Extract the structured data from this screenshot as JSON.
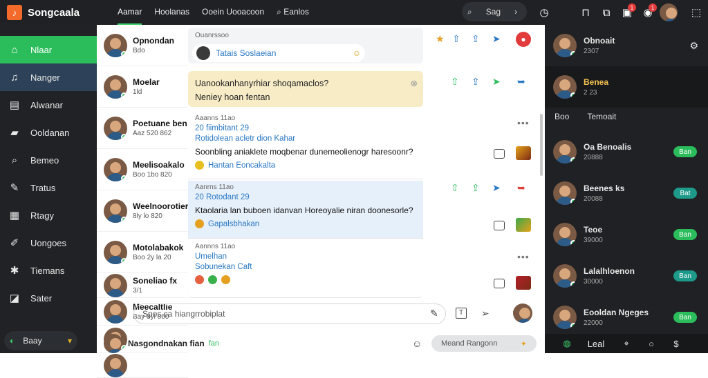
{
  "app": {
    "name": "Songcaala"
  },
  "topnav": {
    "tabs": [
      "Aamar",
      "Hoolanas",
      "Ooein Uooacoon",
      "Eanlos"
    ],
    "search_label": "Sag"
  },
  "sidebar": {
    "items": [
      {
        "label": "Nlaar",
        "icon": "home-icon"
      },
      {
        "label": "Nanger",
        "icon": "music-icon"
      },
      {
        "label": "Alwanar",
        "icon": "library-icon"
      },
      {
        "label": "Ooldanan",
        "icon": "folder-icon"
      },
      {
        "label": "Bemeo",
        "icon": "search-icon"
      },
      {
        "label": "Tratus",
        "icon": "tools-icon"
      },
      {
        "label": "Rtagy",
        "icon": "store-icon"
      },
      {
        "label": "Uongoes",
        "icon": "microphone-icon"
      },
      {
        "label": "Tiemans",
        "icon": "settings-icon"
      },
      {
        "label": "Sater",
        "icon": "bookmark-icon"
      }
    ],
    "toggle_label": "Baay"
  },
  "chats": [
    {
      "name": "Opnondan",
      "sub": "Bdo"
    },
    {
      "name": "Moelar",
      "sub": "1ld"
    },
    {
      "name": "Poetuane ben",
      "sub": "Aaz 520 862"
    },
    {
      "name": "Meelisoakalo",
      "sub": "Boo 1bo 820"
    },
    {
      "name": "Weelnoorotier",
      "sub": "8ly lo 820"
    },
    {
      "name": "Motolabakok",
      "sub": "Boo 2y la 20"
    },
    {
      "name": "Soneliao fx",
      "sub": "3/1"
    },
    {
      "name": "Meecaltlie",
      "sub": "Bay 8yl 860"
    },
    {
      "name": "",
      "sub": ""
    },
    {
      "name": "Nasgondnakan fian",
      "sub": "",
      "tag": "fan"
    }
  ],
  "thread": {
    "sticky_label": "Ouanrssoo",
    "sticky_pill": "Tatais Soslaeian",
    "question": "Uanookanhanyrhiar shoqamaclos?",
    "question_sub": "Neniey hoan fentan",
    "cards": [
      {
        "meta": "Aaanns 11ao",
        "line": "20 fiimbitant   29",
        "body_top": "Rotidolean acletr dion Kahar",
        "body": "Soonbling aniaklete moqbenar dunemeolienogr haresoonr?",
        "foot": "Hantan   Eoncakalta"
      },
      {
        "meta": "Aanrns 11ao",
        "line": "20 Rotodant   29",
        "body": "Ktaolaria lan buboen idanvan Horeoyalie niran doonesorle?",
        "foot": "Gapalsbhakan"
      },
      {
        "meta": "Aannns 11ao",
        "line": "Umelhan",
        "body": "Sobunekan Caft",
        "foot": ""
      }
    ]
  },
  "composer": {
    "placeholder": "Spos ca hiangrrobiplat"
  },
  "bottom": {
    "name": "Nasgondnakan fian",
    "tag": "fan",
    "pill": "Meand Rangonn"
  },
  "right": {
    "profile": {
      "name": "Obnoait",
      "sub": "2307"
    },
    "featured": {
      "name": "Benea",
      "sub": "2 23"
    },
    "tabs": [
      "Boo",
      "Temoait"
    ],
    "contacts": [
      {
        "name": "Oa Benoalis",
        "sub": "20888",
        "btn": "Ban",
        "color": "#2bbd5b"
      },
      {
        "name": "Beenes ks",
        "sub": "20088",
        "btn": "Bat",
        "color": "#1e9a8a"
      },
      {
        "name": "Teoe",
        "sub": "39000",
        "btn": "Ban",
        "color": "#2bbd5b"
      },
      {
        "name": "Lalalhloenon",
        "sub": "30000",
        "btn": "Ban",
        "color": "#1e9a8a"
      },
      {
        "name": "Eooldan Ngeges",
        "sub": "22000",
        "btn": "Ban",
        "color": "#2bbd5b"
      }
    ],
    "bottom_label": "Leal"
  }
}
